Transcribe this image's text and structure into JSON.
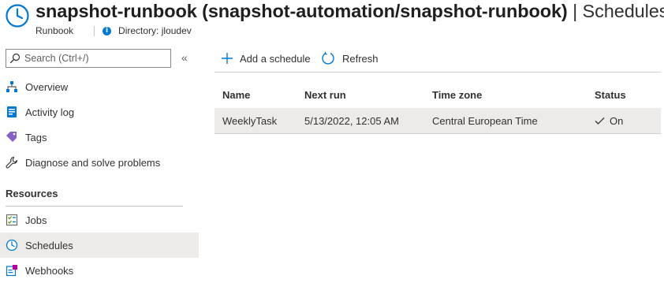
{
  "header": {
    "title_main": "snapshot-runbook (snapshot-automation/snapshot-runbook)",
    "title_sep": " | Schedules",
    "resource_type": "Runbook",
    "directory": "Directory: jloudev",
    "icon": "clock-icon"
  },
  "sidebar": {
    "search": {
      "placeholder": "Search (Ctrl+/)"
    },
    "collapse_glyph": "«",
    "items": [
      {
        "label": "Overview",
        "icon": "overview-icon"
      },
      {
        "label": "Activity log",
        "icon": "activity-log-icon"
      },
      {
        "label": "Tags",
        "icon": "tag-icon"
      },
      {
        "label": "Diagnose and solve problems",
        "icon": "wrench-icon"
      }
    ],
    "resources_header": "Resources",
    "resources": [
      {
        "label": "Jobs",
        "icon": "jobs-icon"
      },
      {
        "label": "Schedules",
        "icon": "clock-icon",
        "active": true
      },
      {
        "label": "Webhooks",
        "icon": "webhook-icon"
      }
    ]
  },
  "toolbar": {
    "add_label": "Add a schedule",
    "refresh_label": "Refresh"
  },
  "table": {
    "columns": [
      "Name",
      "Next run",
      "Time zone",
      "Status"
    ],
    "rows": [
      {
        "name": "WeeklyTask",
        "next_run": "5/13/2022, 12:05 AM",
        "time_zone": "Central European Time",
        "status": "On"
      }
    ]
  },
  "colors": {
    "accent": "#0078d4",
    "selected_bg": "#edebe9",
    "text": "#323130"
  }
}
